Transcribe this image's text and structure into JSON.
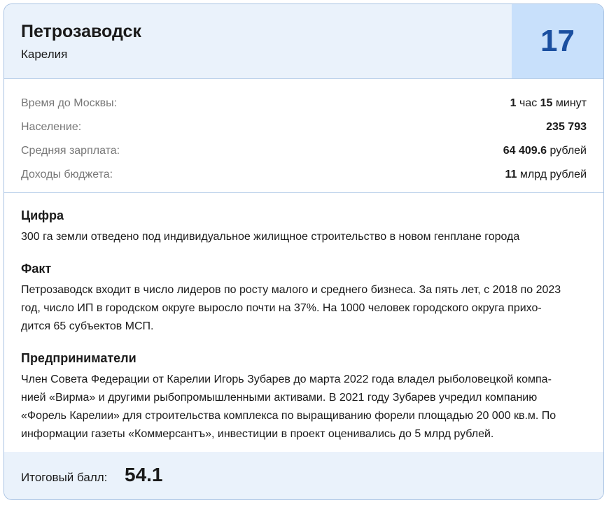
{
  "header": {
    "city": "Петрозаводск",
    "region": "Карелия",
    "rank": "17"
  },
  "stats": [
    {
      "label": "Время до Москвы:",
      "value_parts": [
        {
          "text": "1",
          "bold": true
        },
        {
          "text": " час ",
          "bold": false
        },
        {
          "text": "15",
          "bold": true
        },
        {
          "text": " минут",
          "bold": false
        }
      ]
    },
    {
      "label": "Население:",
      "value_parts": [
        {
          "text": "235 793",
          "bold": true
        }
      ]
    },
    {
      "label": "Средняя зарплата:",
      "value_parts": [
        {
          "text": "64 409.6",
          "bold": true
        },
        {
          "text": " рублей",
          "bold": false
        }
      ]
    },
    {
      "label": "Доходы бюджета:",
      "value_parts": [
        {
          "text": "11",
          "bold": true
        },
        {
          "text": " млрд рублей",
          "bold": false
        }
      ]
    }
  ],
  "sections": {
    "figure": {
      "title": "Цифра",
      "text": "300 га земли отведено под индивидуальное жилищное строительство в новом генплане города"
    },
    "fact": {
      "title": "Факт",
      "lines": [
        "Петрозаводск входит в число лидеров по росту малого и среднего бизнеса. За пять лет, с 2018 по 2023",
        "год, число ИП в городском округе выросло почти на 37%. На 1000 человек городского округа прихо-",
        "дится 65 субъектов МСП."
      ]
    },
    "entrepreneurs": {
      "title": "Предприниматели",
      "lines": [
        "Член Совета Федерации от Карелии Игорь Зубарев до марта 2022 года владел рыболовецкой компа-",
        "нией «Вирма» и другими рыбопромышленными активами. В 2021 году Зубарев учредил компанию",
        "«Форель Карелии» для строительства комплекса по выращиванию форели площадью 20 000 кв.м. По",
        "информации газеты «Коммерсантъ», инвестиции в проект оценивались до 5 млрд рублей."
      ]
    }
  },
  "footer": {
    "score_label": "Итоговый балл:",
    "score_value": "54.1"
  }
}
